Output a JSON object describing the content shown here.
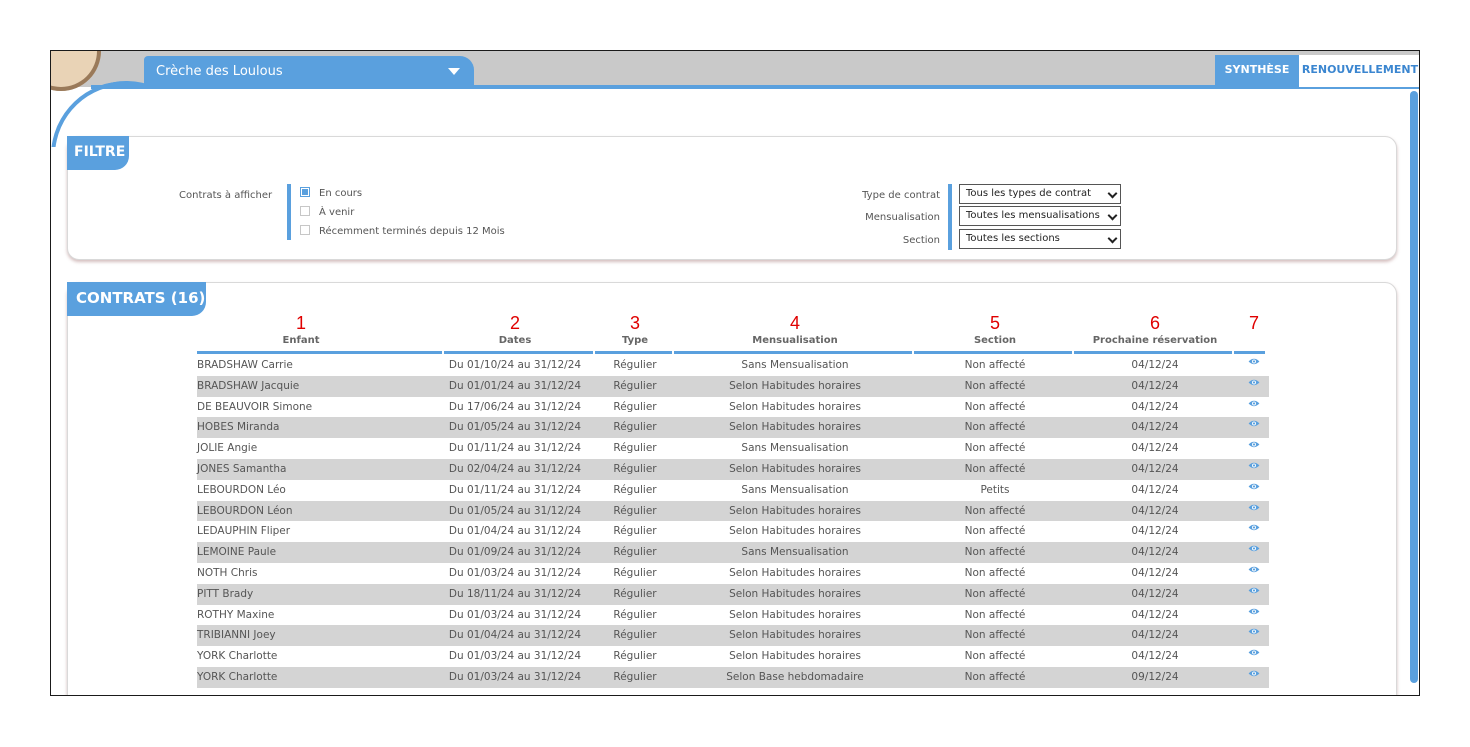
{
  "header": {
    "creche_name": "Crèche des Loulous",
    "tabs": [
      {
        "label": "SYNTHÈSE",
        "active": true
      },
      {
        "label": "RENOUVELLEMENT",
        "active": false
      }
    ]
  },
  "colors": {
    "accent": "#5aa0de",
    "row_alt": "#d4d4d4",
    "annotation": "#e00000"
  },
  "filter": {
    "title": "FILTRE",
    "contracts_label": "Contrats à afficher",
    "checkboxes": [
      {
        "label": "En cours",
        "checked": true
      },
      {
        "label": "À venir",
        "checked": false
      },
      {
        "label": "Récemment terminés depuis 12 Mois",
        "checked": false
      }
    ],
    "type_contrat": {
      "label": "Type de contrat",
      "value": "Tous les types de contrat"
    },
    "mensualisation": {
      "label": "Mensualisation",
      "value": "Toutes les mensualisations"
    },
    "section": {
      "label": "Section",
      "value": "Toutes les sections"
    }
  },
  "contrats": {
    "title": "CONTRATS (16)",
    "column_numbers": [
      "1",
      "2",
      "3",
      "4",
      "5",
      "6",
      "7"
    ],
    "columns": [
      "Enfant",
      "Dates",
      "Type",
      "Mensualisation",
      "Section",
      "Prochaine réservation"
    ],
    "action_icon": "eye-icon",
    "rows": [
      {
        "enfant": "BRADSHAW Carrie",
        "dates": "Du 01/10/24 au 31/12/24",
        "type": "Régulier",
        "mensualisation": "Sans Mensualisation",
        "section": "Non affecté",
        "prochaine": "04/12/24"
      },
      {
        "enfant": "BRADSHAW Jacquie",
        "dates": "Du 01/01/24 au 31/12/24",
        "type": "Régulier",
        "mensualisation": "Selon Habitudes horaires",
        "section": "Non affecté",
        "prochaine": "04/12/24"
      },
      {
        "enfant": "DE BEAUVOIR Simone",
        "dates": "Du 17/06/24 au 31/12/24",
        "type": "Régulier",
        "mensualisation": "Selon Habitudes horaires",
        "section": "Non affecté",
        "prochaine": "04/12/24"
      },
      {
        "enfant": "HOBES Miranda",
        "dates": "Du 01/05/24 au 31/12/24",
        "type": "Régulier",
        "mensualisation": "Selon Habitudes horaires",
        "section": "Non affecté",
        "prochaine": "04/12/24"
      },
      {
        "enfant": "JOLIE Angie",
        "dates": "Du 01/11/24 au 31/12/24",
        "type": "Régulier",
        "mensualisation": "Sans Mensualisation",
        "section": "Non affecté",
        "prochaine": "04/12/24"
      },
      {
        "enfant": "JONES Samantha",
        "dates": "Du 02/04/24 au 31/12/24",
        "type": "Régulier",
        "mensualisation": "Selon Habitudes horaires",
        "section": "Non affecté",
        "prochaine": "04/12/24"
      },
      {
        "enfant": "LEBOURDON Léo",
        "dates": "Du 01/11/24 au 31/12/24",
        "type": "Régulier",
        "mensualisation": "Sans Mensualisation",
        "section": "Petits",
        "prochaine": "04/12/24"
      },
      {
        "enfant": "LEBOURDON Léon",
        "dates": "Du 01/05/24 au 31/12/24",
        "type": "Régulier",
        "mensualisation": "Selon Habitudes horaires",
        "section": "Non affecté",
        "prochaine": "04/12/24"
      },
      {
        "enfant": "LEDAUPHIN Fliper",
        "dates": "Du 01/04/24 au 31/12/24",
        "type": "Régulier",
        "mensualisation": "Selon Habitudes horaires",
        "section": "Non affecté",
        "prochaine": "04/12/24"
      },
      {
        "enfant": "LEMOINE Paule",
        "dates": "Du 01/09/24 au 31/12/24",
        "type": "Régulier",
        "mensualisation": "Sans Mensualisation",
        "section": "Non affecté",
        "prochaine": "04/12/24"
      },
      {
        "enfant": "NOTH Chris",
        "dates": "Du 01/03/24 au 31/12/24",
        "type": "Régulier",
        "mensualisation": "Selon Habitudes horaires",
        "section": "Non affecté",
        "prochaine": "04/12/24"
      },
      {
        "enfant": "PITT Brady",
        "dates": "Du 18/11/24 au 31/12/24",
        "type": "Régulier",
        "mensualisation": "Selon Habitudes horaires",
        "section": "Non affecté",
        "prochaine": "04/12/24"
      },
      {
        "enfant": "ROTHY Maxine",
        "dates": "Du 01/03/24 au 31/12/24",
        "type": "Régulier",
        "mensualisation": "Selon Habitudes horaires",
        "section": "Non affecté",
        "prochaine": "04/12/24"
      },
      {
        "enfant": "TRIBIANNI Joey",
        "dates": "Du 01/04/24 au 31/12/24",
        "type": "Régulier",
        "mensualisation": "Selon Habitudes horaires",
        "section": "Non affecté",
        "prochaine": "04/12/24"
      },
      {
        "enfant": "YORK Charlotte",
        "dates": "Du 01/03/24 au 31/12/24",
        "type": "Régulier",
        "mensualisation": "Selon Habitudes horaires",
        "section": "Non affecté",
        "prochaine": "04/12/24"
      },
      {
        "enfant": "YORK Charlotte",
        "dates": "Du 01/03/24 au 31/12/24",
        "type": "Régulier",
        "mensualisation": "Selon Base hebdomadaire",
        "section": "Non affecté",
        "prochaine": "09/12/24"
      }
    ]
  }
}
